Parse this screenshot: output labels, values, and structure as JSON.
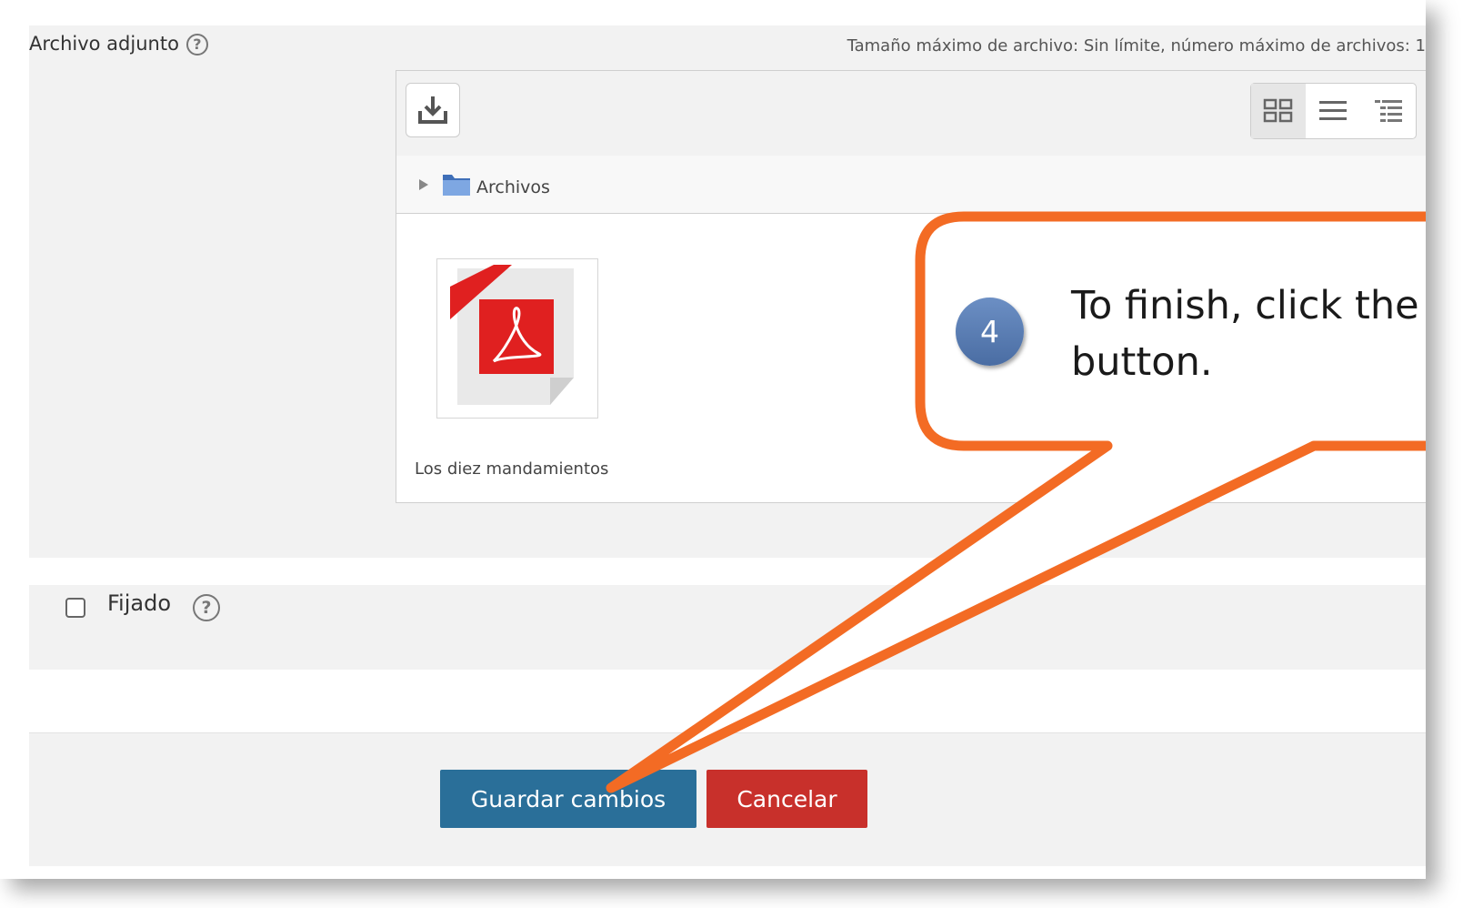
{
  "attachment": {
    "label": "Archivo adjunto",
    "limits": "Tamaño máximo de archivo: Sin límite, número máximo de archivos: 1",
    "help_icon": "?"
  },
  "filemanager": {
    "path_label": "Archivos",
    "files": [
      {
        "name": "Los diez mandamientos",
        "type": "pdf"
      }
    ]
  },
  "pinned": {
    "label": "Fijado",
    "checked": false
  },
  "actions": {
    "save_label": "Guardar cambios",
    "cancel_label": "Cancelar"
  },
  "callout": {
    "step": "4",
    "text_line1": "To finish, click the “",
    "text_line2": "button."
  },
  "colors": {
    "save": "#2a6f99",
    "cancel": "#c8302b",
    "callout_border": "#f36b24",
    "step_badge": "#5a7db5"
  }
}
